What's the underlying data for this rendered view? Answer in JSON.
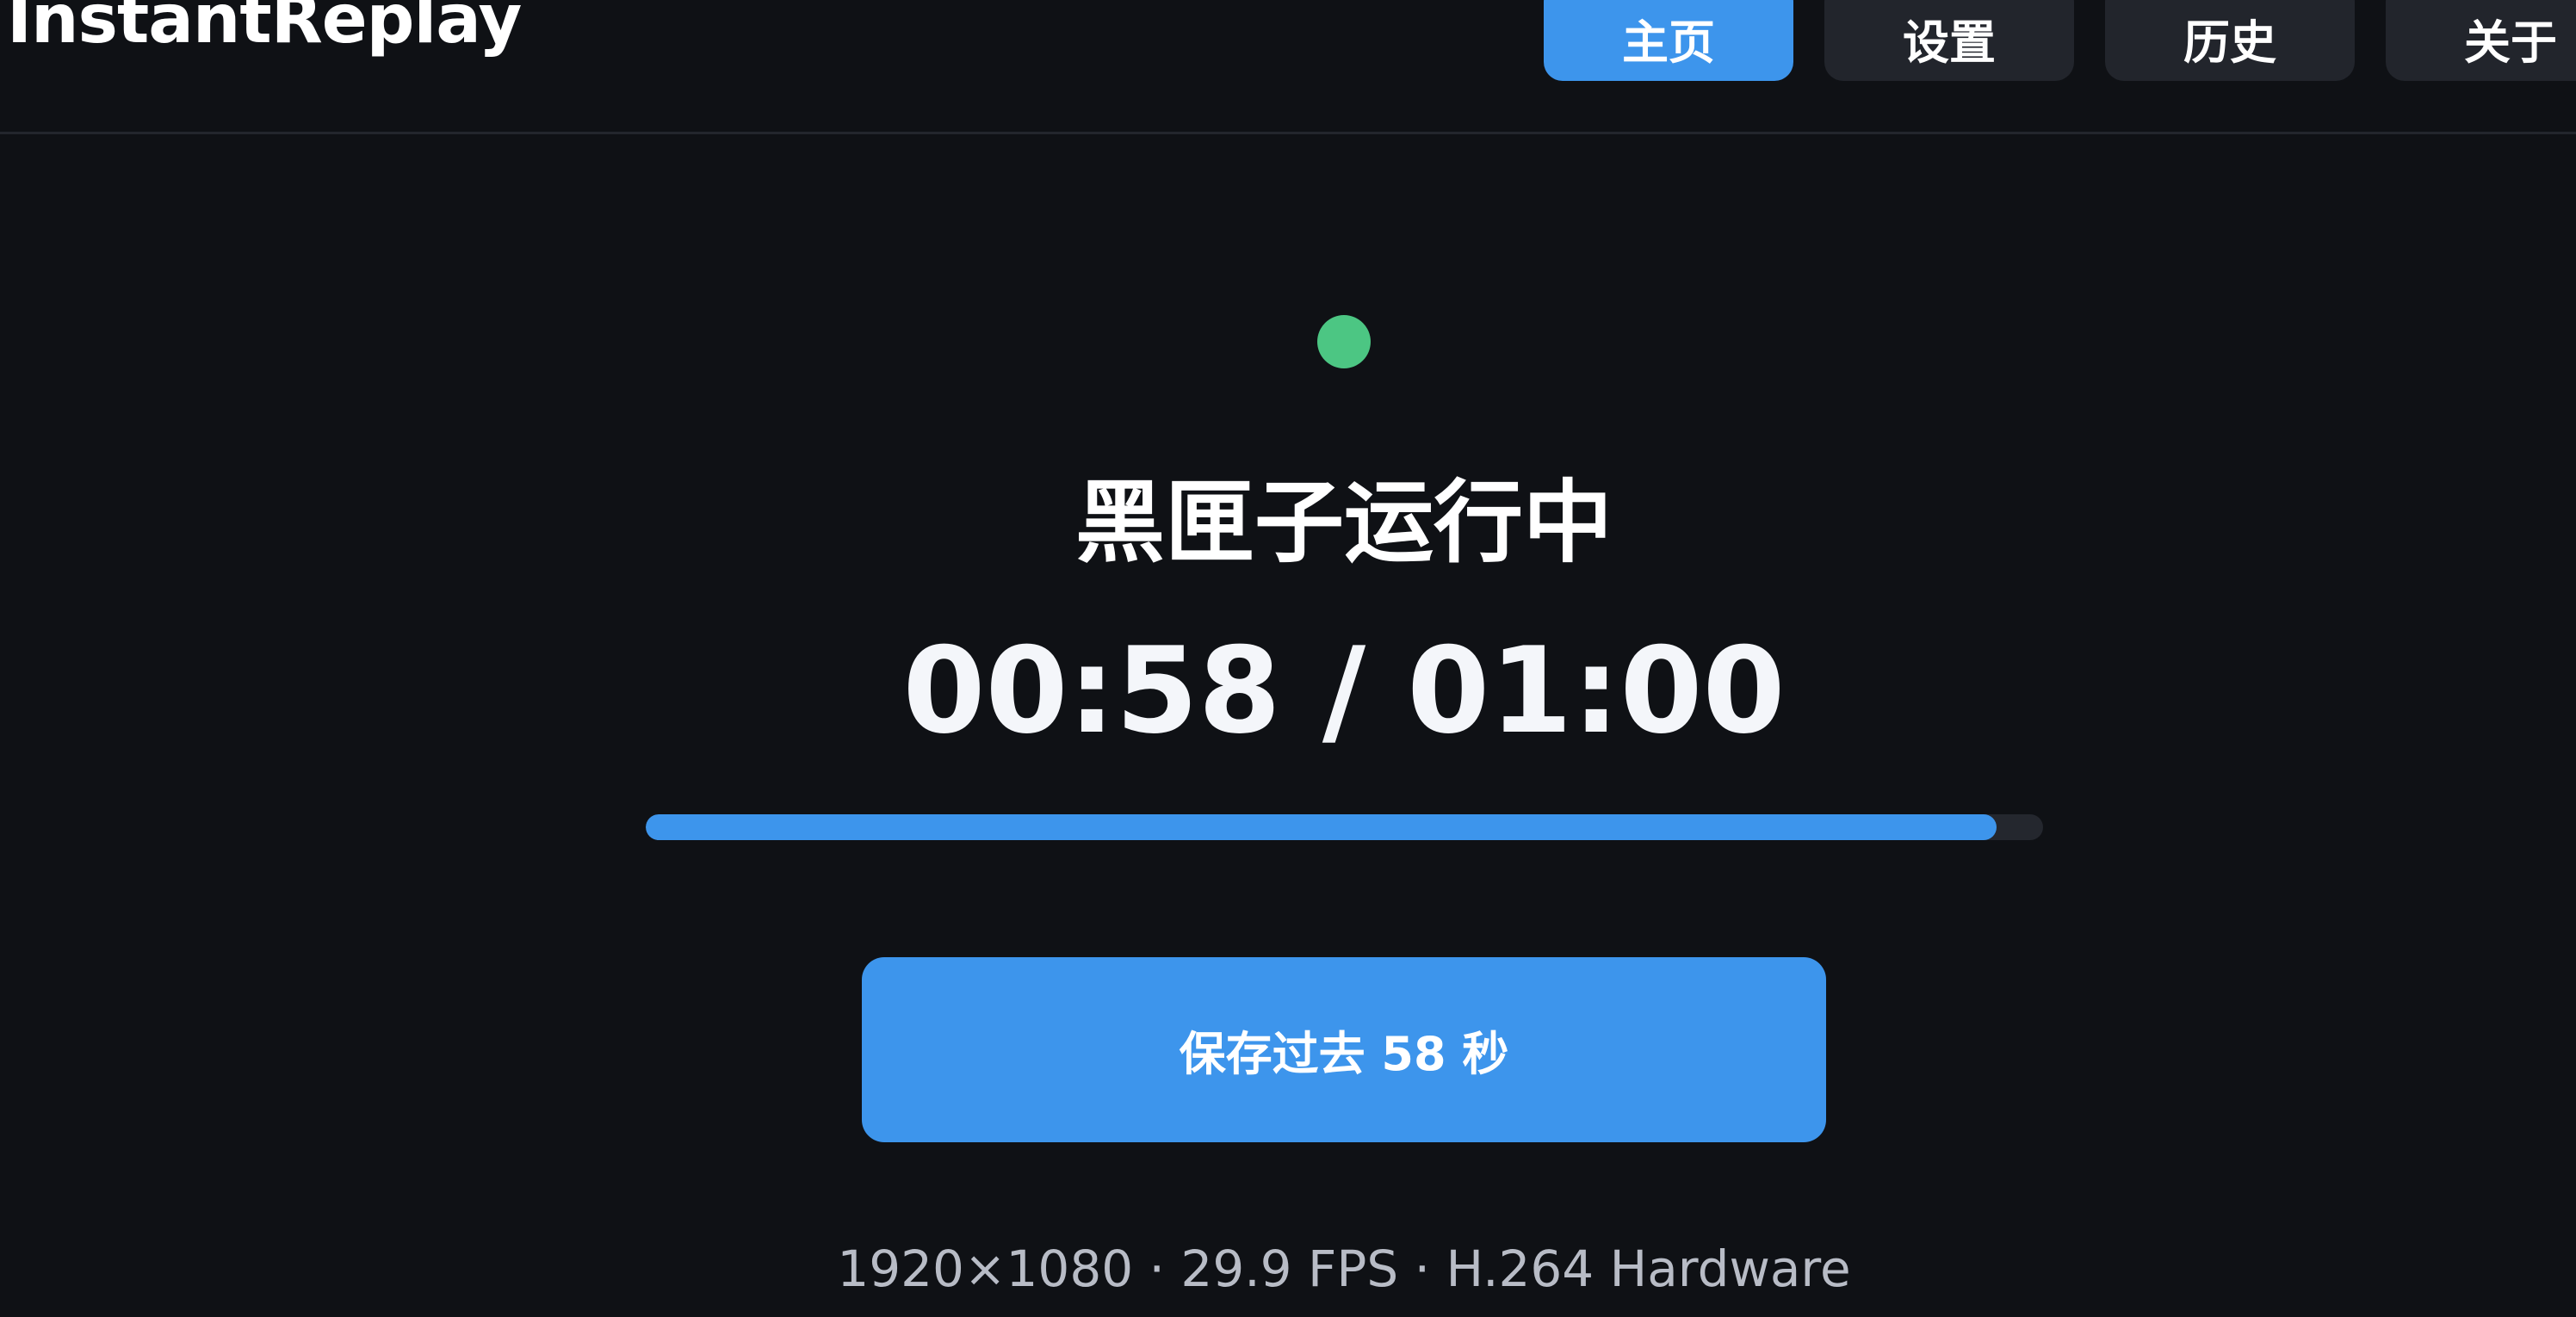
{
  "header": {
    "app_title": "InstantReplay",
    "tabs": [
      {
        "label": "主页",
        "active": true
      },
      {
        "label": "设置",
        "active": false
      },
      {
        "label": "历史",
        "active": false
      },
      {
        "label": "关于",
        "active": false
      }
    ]
  },
  "main": {
    "status_indicator": {
      "icon": "status-dot-icon",
      "color": "#4cc683"
    },
    "status_text": "黑匣子运行中",
    "timer": {
      "text": "00:58 / 01:00",
      "elapsed_seconds": 58,
      "total_seconds": 60
    },
    "progress": {
      "fraction": 0.967,
      "color": "#3d95ec",
      "track_color": "#24272e"
    },
    "save_button_label": "保存过去 58 秒",
    "stream_info": "1920×1080 · 29.9 FPS · H.264 Hardware"
  },
  "colors": {
    "background": "#0f1115",
    "accent": "#3d95ec",
    "inactive_tab": "#22252c",
    "success": "#4cc683"
  }
}
